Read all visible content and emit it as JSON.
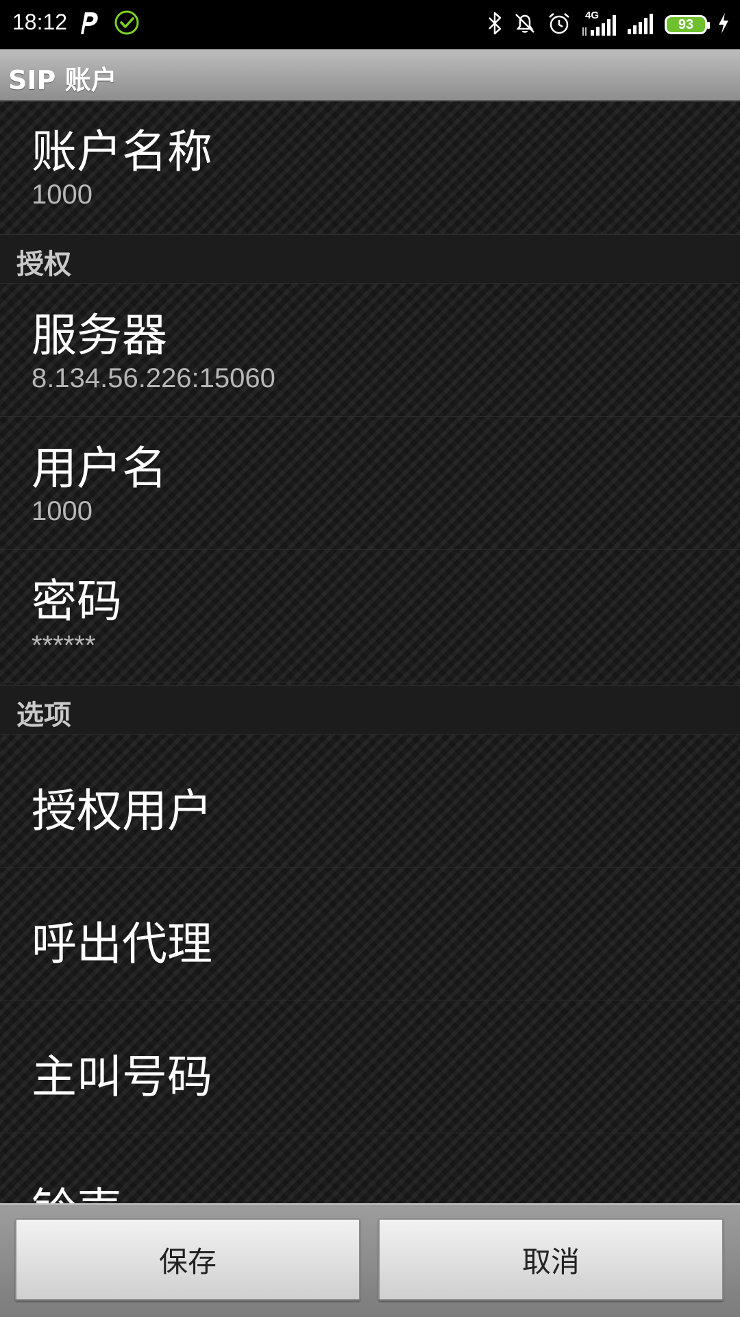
{
  "status_bar": {
    "time": "18:12",
    "left_icons": [
      "parking-p-icon",
      "check-circle-icon"
    ],
    "right_icons": [
      "bluetooth-icon",
      "bell-muted-icon",
      "alarm-icon",
      "signal-4g-icon",
      "signal-icon",
      "battery-icon",
      "charging-icon"
    ],
    "network": "4G",
    "battery_level": "93",
    "battery_color": "#6fbf2f"
  },
  "action_bar": {
    "title": "SIP 账户"
  },
  "list": {
    "account_name": {
      "title": "账户名称",
      "summary": "1000"
    },
    "category_auth": "授权",
    "server": {
      "title": "服务器",
      "summary": "8.134.56.226:15060"
    },
    "username": {
      "title": "用户名",
      "summary": "1000"
    },
    "password": {
      "title": "密码",
      "summary": "******"
    },
    "category_options": "选项",
    "auth_user": {
      "title": "授权用户"
    },
    "outbound_proxy": {
      "title": "呼出代理"
    },
    "caller_number": {
      "title": "主叫号码"
    },
    "ringtone": {
      "title": "铃声"
    }
  },
  "buttons": {
    "save": "保存",
    "cancel": "取消"
  }
}
